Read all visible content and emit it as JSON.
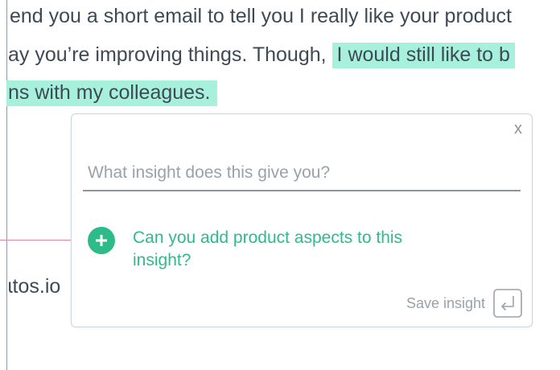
{
  "document": {
    "line1": "end you a short email to tell you I really like your product",
    "line2_plain": "ay you’re improving things. Though,",
    "line2_highlight": "I would still like to b",
    "line3_highlight": "ns with my colleagues.",
    "line4": "ɩtos.io"
  },
  "insight_card": {
    "close_label": "x",
    "input_value": "",
    "input_placeholder": "What insight does this give you?",
    "add_aspects_label": "Can you add product aspects to this insight?",
    "save_label": "Save insight"
  },
  "colors": {
    "highlight": "#a7f1dc",
    "accent": "#2dbb8a",
    "connector": "#e884a8"
  },
  "icons": {
    "close": "close-icon",
    "add": "plus-circle-icon",
    "save": "enter-key-icon"
  }
}
